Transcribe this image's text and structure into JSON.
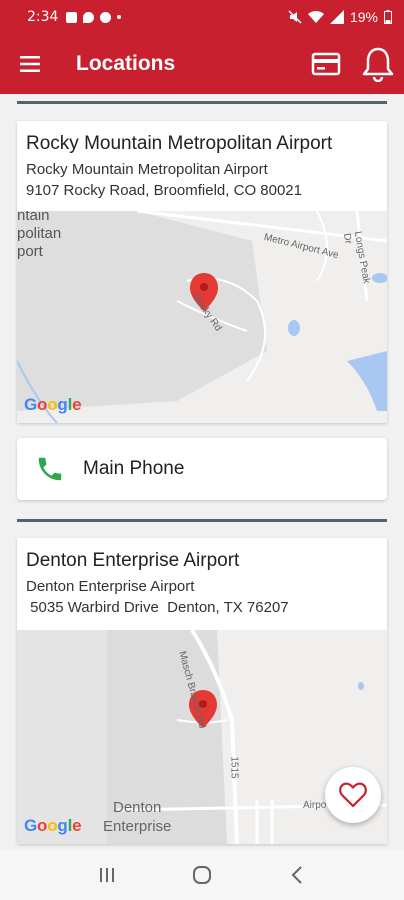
{
  "status_bar": {
    "time": "2:34",
    "battery": "19%"
  },
  "app_bar": {
    "title": "Locations",
    "menu_icon": "menu-icon",
    "card_icon": "credit-card-icon",
    "bell_icon": "bell-icon"
  },
  "colors": {
    "brand": "#c8202f",
    "divider": "#55636b",
    "phone_green": "#2ea84a",
    "pin_red": "#e53935"
  },
  "locations": [
    {
      "name": "Rocky Mountain Metropolitan Airport",
      "subtitle": "Rocky Mountain Metropolitan Airport",
      "address": "9107 Rocky Road, Broomfield, CO 80021",
      "map_labels": {
        "area_line1": "ntain",
        "area_line2": "politan",
        "area_line3": "port",
        "road1": "Metro Airport Ave",
        "road2": "Rocky Rd",
        "road3": "Longs Peak Dr"
      }
    },
    {
      "name": "Denton Enterprise Airport",
      "subtitle": "Denton Enterprise Airport",
      "address": " 5035 Warbird Drive  Denton, TX 76207",
      "map_labels": {
        "road1": "Masch Branch Rd",
        "road2": "1515",
        "area_line1": "Denton",
        "area_line2": "Enterprise",
        "road3": "Airpo"
      }
    }
  ],
  "phone": {
    "label": "Main Phone",
    "icon": "phone-icon"
  },
  "map_attribution": "Google",
  "fab": {
    "icon": "heart-icon"
  },
  "nav": {
    "recent_icon": "recent-apps-icon",
    "home_icon": "home-icon",
    "back_icon": "back-icon"
  }
}
